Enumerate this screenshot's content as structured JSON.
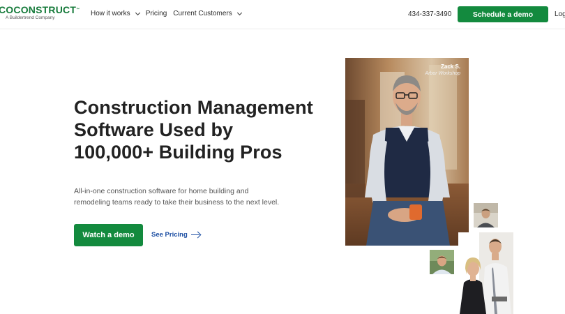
{
  "header": {
    "logo_text": "COCONSTRUCT",
    "logo_tm": "™",
    "logo_sub": "A Buildertrend Company",
    "nav": [
      {
        "label": "How it works",
        "has_dropdown": true
      },
      {
        "label": "Pricing",
        "has_dropdown": false
      },
      {
        "label": "Current Customers",
        "has_dropdown": true
      }
    ],
    "phone": "434-337-3490",
    "cta": "Schedule a demo",
    "login": "Log"
  },
  "hero": {
    "headline_lines": [
      "Construction Management",
      "Software Used by",
      "100,000+ Building Pros"
    ],
    "subtext_lines": [
      "All-in-one construction software for home building and",
      "remodeling teams ready to take their business to the next level."
    ],
    "primary_cta": "Watch a demo",
    "secondary_cta": "See Pricing"
  },
  "testimonial": {
    "name": "Zack S.",
    "company": "Arbor Workshop"
  },
  "colors": {
    "brand_green": "#138a3e",
    "link_blue": "#1d4fa3"
  }
}
